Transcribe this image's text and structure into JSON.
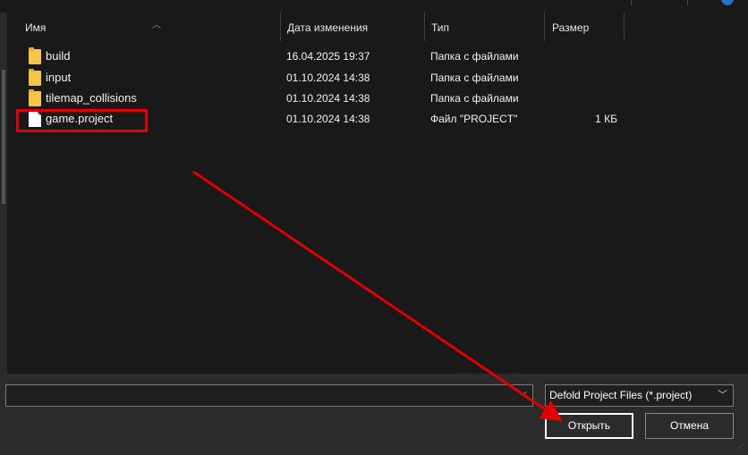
{
  "columns": {
    "name": "Имя",
    "date": "Дата изменения",
    "type": "Тип",
    "size": "Размер"
  },
  "files": [
    {
      "name": "build",
      "date": "16.04.2025 19:37",
      "type": "Папка с файлами",
      "size": "",
      "icon": "folder-icon"
    },
    {
      "name": "input",
      "date": "01.10.2024 14:38",
      "type": "Папка с файлами",
      "size": "",
      "icon": "folder-icon"
    },
    {
      "name": "tilemap_collisions",
      "date": "01.10.2024 14:38",
      "type": "Папка с файлами",
      "size": "",
      "icon": "folder-icon"
    },
    {
      "name": "game.project",
      "date": "01.10.2024 14:38",
      "type": "Файл \"PROJECT\"",
      "size": "1 КБ",
      "icon": "file-icon"
    }
  ],
  "footer": {
    "filename_value": "",
    "filetype_selected": "Defold Project Files (*.project)",
    "open_label": "Открыть",
    "cancel_label": "Отмена"
  },
  "colors": {
    "background": "#191919",
    "bottom_panel": "#2b2b2b",
    "annotation": "#e00000",
    "folder": "#f5c645"
  }
}
